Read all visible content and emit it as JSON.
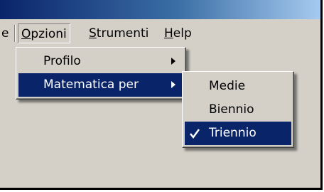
{
  "menubar": {
    "partial_item": "e",
    "items": [
      {
        "label_first": "O",
        "label_rest": "pzioni"
      },
      {
        "label_first": "S",
        "label_rest": "trumenti"
      },
      {
        "label_first": "H",
        "label_rest": "elp"
      }
    ]
  },
  "opzioni_menu": {
    "items": [
      {
        "label": "Profilo"
      },
      {
        "label": "Matematica per"
      }
    ]
  },
  "matematica_submenu": {
    "items": [
      {
        "label": "Medie",
        "checked": false
      },
      {
        "label": "Biennio",
        "checked": false
      },
      {
        "label": "Triennio",
        "checked": true
      }
    ]
  },
  "colors": {
    "menu_background": "#d4d0c8",
    "highlight": "#0a246a",
    "highlight_text": "#ffffff"
  }
}
